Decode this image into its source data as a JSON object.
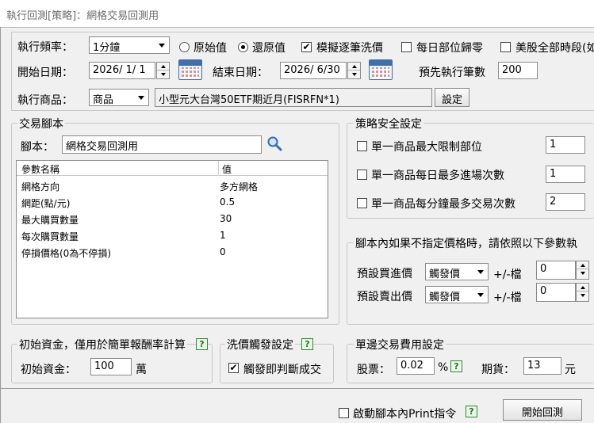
{
  "window": {
    "title": "執行回測[策略]：網格交易回測用"
  },
  "settings": {
    "frequency_label": "執行頻率：",
    "frequency_value": "1分鐘",
    "radio_original": "原始值",
    "radio_restored": "還原值",
    "radio_selected": "還原值",
    "check_simulate": "模擬逐筆洗價",
    "check_simulate_checked": true,
    "check_daily_reset": "每日部位歸零",
    "check_daily_reset_checked": false,
    "check_us_all": "美股全部時段(如",
    "check_us_all_checked": false,
    "start_label": "開始日期：",
    "start_value": "2026/  1/  1",
    "end_label": "結束日期：",
    "end_value": "2026/  6/30",
    "preexec_label": "預先執行筆數",
    "preexec_value": "200",
    "product_label": "執行商品：",
    "product_type": "商品",
    "product_name": "小型元大台灣50ETF期近月(FISRFN*1)",
    "set_button": "設定"
  },
  "script_panel": {
    "title": "交易腳本",
    "script_label": "腳本：",
    "script_value": "網格交易回測用",
    "columns": [
      "參數名稱",
      "值"
    ],
    "params": [
      {
        "name": "網格方向",
        "value": "多方網格"
      },
      {
        "name": "網距(點/元)",
        "value": "0.5"
      },
      {
        "name": "最大購買數量",
        "value": "30"
      },
      {
        "name": "每次購買數量",
        "value": "1"
      },
      {
        "name": "停損價格(0為不停損)",
        "value": "0"
      }
    ]
  },
  "safety": {
    "title": "策略安全設定",
    "rows": [
      {
        "label": "單一商品最大限制部位",
        "value": "1",
        "checked": false
      },
      {
        "label": "單一商品每日最多進場次數",
        "value": "1",
        "checked": false
      },
      {
        "label": "單一商品每分鐘最多交易次數",
        "value": "2",
        "checked": false
      }
    ]
  },
  "price_defaults": {
    "title": "腳本內如果不指定價格時，請依照以下參數執",
    "buy_label": "預設買進價",
    "buy_value": "觸發價",
    "buy_tick_label": "+/-檔",
    "buy_tick_value": "0",
    "sell_label": "預設賣出價",
    "sell_value": "觸發價",
    "sell_tick_label": "+/-檔",
    "sell_tick_value": "0"
  },
  "capital": {
    "title": "初始資金，僅用於簡單報酬率計算",
    "label": "初始資金：",
    "value": "100",
    "unit": "萬"
  },
  "trigger": {
    "title": "洗價觸發設定",
    "check_label": "觸發即判斷成交",
    "checked": true
  },
  "fees": {
    "title": "單邊交易費用設定",
    "stock_label": "股票：",
    "stock_value": "0.02",
    "stock_unit": "%",
    "futures_label": "期貨：",
    "futures_value": "13",
    "futures_unit": "元"
  },
  "footer": {
    "print_label": "啟動腳本內Print指令",
    "print_checked": false,
    "start_button": "開始回測"
  },
  "icons": {
    "help_glyph": "?",
    "check_glyph": "✔"
  },
  "colors": {
    "help_green": "#1f7a1f",
    "calendar_blue": "#3c6fb0"
  }
}
